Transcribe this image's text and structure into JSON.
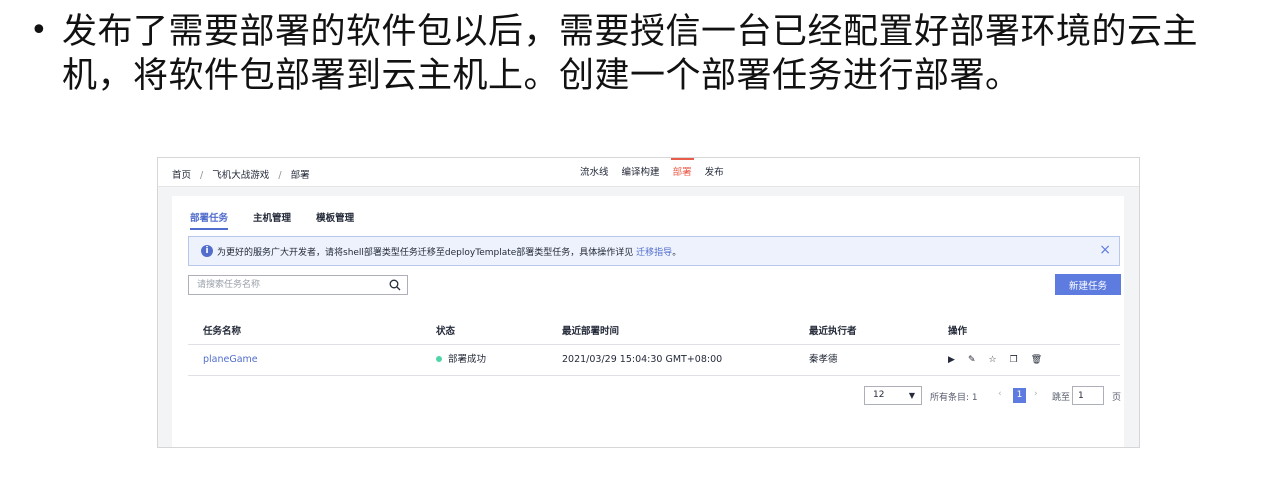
{
  "slide": {
    "bullet": "•",
    "text": "发布了需要部署的软件包以后，需要授信一台已经配置好部署环境的云主机，将软件包部署到云主机上。创建一个部署任务进行部署。"
  },
  "breadcrumb": [
    "首页",
    "飞机大战游戏",
    "部署"
  ],
  "breadcrumb_sep": "/",
  "topnav": [
    "流水线",
    "编译构建",
    "部署",
    "发布"
  ],
  "tabs": [
    "部署任务",
    "主机管理",
    "模板管理"
  ],
  "notice": {
    "text": "为更好的服务广大开发者，请将shell部署类型任务迁移至deployTemplate部署类型任务，具体操作详见",
    "link": "迁移指导",
    "tail": "。",
    "close": "×"
  },
  "search": {
    "placeholder": "请搜索任务名称"
  },
  "new_task_button": "新建任务",
  "table": {
    "headers": [
      "任务名称",
      "状态",
      "最近部署时间",
      "最近执行者",
      "操作"
    ],
    "rows": [
      {
        "name": "planeGame",
        "status": "部署成功",
        "time": "2021/03/29 15:04:30 GMT+08:00",
        "executor": "秦孝德"
      }
    ]
  },
  "pagination": {
    "page_size": "12",
    "total": "所有条目: 1",
    "current_page": "1",
    "jump_label": "跳至",
    "jump_value": "1",
    "page_suffix": "页"
  },
  "colors": {
    "accent": "#5e7ce0",
    "active_nav": "#e85c4a",
    "success": "#50d4ab"
  },
  "icons": [
    "info-icon",
    "close-icon",
    "search-icon",
    "play-icon",
    "edit-icon",
    "star-icon",
    "copy-icon",
    "delete-icon",
    "caret-down-icon",
    "chevron-left-icon",
    "chevron-right-icon"
  ]
}
